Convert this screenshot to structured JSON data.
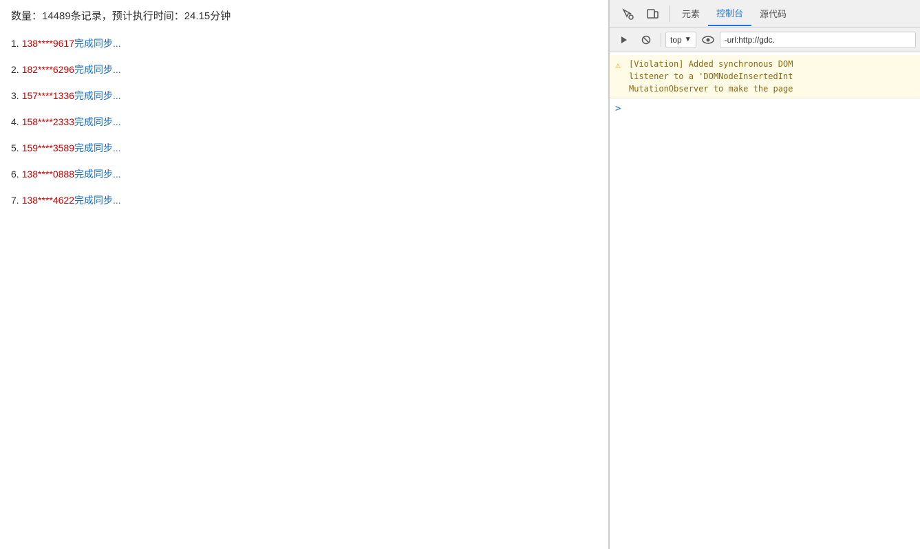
{
  "left": {
    "status": "数量：14489条记录，预计执行时间：24.15分钟",
    "items": [
      {
        "number": "1.",
        "phone": "138****9617",
        "suffix": "完成同步..."
      },
      {
        "number": "2.",
        "phone": "182****6296",
        "suffix": "完成同步..."
      },
      {
        "number": "3.",
        "phone": "157****1336",
        "suffix": "完成同步..."
      },
      {
        "number": "4.",
        "phone": "158****2333",
        "suffix": "完成同步..."
      },
      {
        "number": "5.",
        "phone": "159****3589",
        "suffix": "完成同步..."
      },
      {
        "number": "6.",
        "phone": "138****0888",
        "suffix": "完成同步..."
      },
      {
        "number": "7.",
        "phone": "138****4622",
        "suffix": "完成同步..."
      }
    ]
  },
  "devtools": {
    "tabs": [
      {
        "label": "元素",
        "active": false
      },
      {
        "label": "控制台",
        "active": true
      },
      {
        "label": "源代码",
        "active": false
      }
    ],
    "top_selector": "top",
    "filter_placeholder": "-url:http://gdc.",
    "console_message": "[Violation] Added synchronous DOM\nlistener to a 'DOMNodeInsertedInt\nMutationObserver to make the page",
    "prompt_arrow": ">"
  }
}
